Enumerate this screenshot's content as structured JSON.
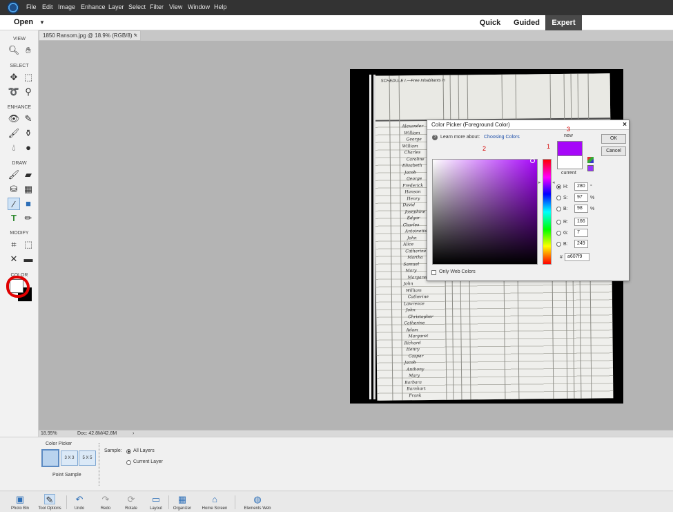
{
  "menu": [
    "File",
    "Edit",
    "Image",
    "Enhance",
    "Layer",
    "Select",
    "Filter",
    "View",
    "Window",
    "Help"
  ],
  "header": {
    "open_label": "Open",
    "modes": [
      "Quick",
      "Guided",
      "Expert"
    ],
    "active_mode": "Expert"
  },
  "document_tab": {
    "title": "1850 Ransom.jpg @ 18.9% (RGB/8) *",
    "close": "×"
  },
  "toolbox": {
    "sections": [
      "VIEW",
      "SELECT",
      "ENHANCE",
      "DRAW",
      "MODIFY",
      "COLOR"
    ],
    "icons": [
      "zoom-tool",
      "hand-tool",
      "move-tool",
      "marquee-tool",
      "lasso-tool",
      "quick-selection-tool",
      "red-eye-tool",
      "spot-healing-tool",
      "smart-brush-tool",
      "clone-stamp-tool",
      "blur-tool",
      "sponge-tool",
      "brush-tool",
      "eraser-tool",
      "paint-bucket-tool",
      "gradient-tool",
      "eyedropper-tool",
      "shape-tool",
      "type-tool",
      "pencil-tool",
      "crop-tool",
      "recompose-tool",
      "content-aware-move-tool",
      "straighten-tool"
    ],
    "active_tool": "eyedropper-tool",
    "foreground_color": "#ffffff",
    "background_color": "#000000"
  },
  "color_picker": {
    "title": "Color Picker (Foreground Color)",
    "close": "×",
    "learn_more": "Learn more about:",
    "learn_link": "Choosing Colors",
    "new_label": "new",
    "current_label": "current",
    "new_color": "#a607f9",
    "current_color": "#ffffff",
    "ok_label": "OK",
    "cancel_label": "Cancel",
    "fields": {
      "H": {
        "label": "H:",
        "value": "280",
        "unit": "°"
      },
      "S": {
        "label": "S:",
        "value": "97",
        "unit": "%"
      },
      "B": {
        "label": "B:",
        "value": "98",
        "unit": "%"
      },
      "R": {
        "label": "R:",
        "value": "166"
      },
      "G": {
        "label": "G:",
        "value": "7"
      },
      "Bl": {
        "label": "B:",
        "value": "249"
      }
    },
    "selected_field": "H",
    "hex_label": "#",
    "hex_value": "a607f9",
    "only_web_colors": "Only Web Colors",
    "annotations": [
      "1",
      "2",
      "3"
    ]
  },
  "census": {
    "heading": "SCHEDULE I.—Free Inhabitants in",
    "names": [
      "Alexander",
      "William",
      "George",
      "William",
      "Charles",
      "Caroline",
      "Elizabeth",
      "Jacob",
      "George",
      "Frederick",
      "Hanson",
      "Henry",
      "David",
      "Josephine",
      "Edgar",
      "Charles",
      "Antoinette",
      "John",
      "Alice",
      "Catherine",
      "Martha",
      "Samuel",
      "Mary",
      "Margaret",
      "John",
      "William",
      "Catherine",
      "Lawrence",
      "John",
      "Christopher",
      "Catherine",
      "Adam",
      "Margaret",
      "Richard",
      "Henry",
      "Caspar",
      "Jacob",
      "Anthony",
      "Mary",
      "Barbara",
      "Barnhart",
      "Frank"
    ]
  },
  "status": {
    "zoom": "18.95%",
    "doc": "Doc: 42.8M/42.8M",
    "arrow": "›"
  },
  "tool_options": {
    "title": "Color Picker",
    "sample_sizes": [
      "3 X 3",
      "5 X 5"
    ],
    "point_sample_label": "Point Sample",
    "sample_label": "Sample:",
    "sample_options": [
      "All Layers",
      "Current Layer"
    ],
    "selected_sample": "All Layers"
  },
  "taskbar": [
    "Photo Bin",
    "Tool Options",
    "Undo",
    "Redo",
    "Rotate",
    "Layout",
    "Organizer",
    "Home Screen",
    "Elements Web"
  ]
}
